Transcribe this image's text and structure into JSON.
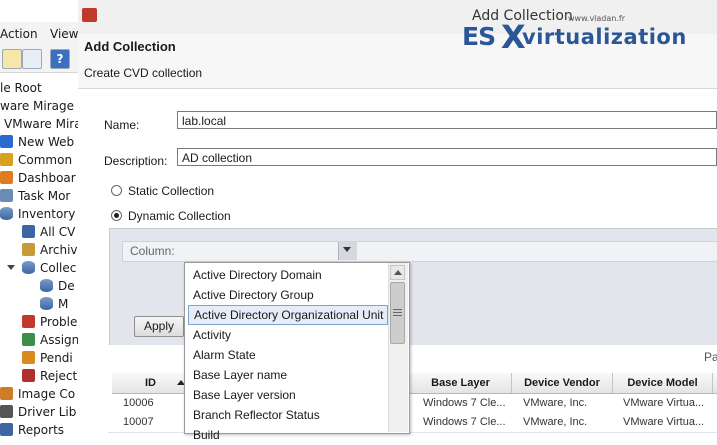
{
  "app": {
    "menu": [
      "Action",
      "View"
    ],
    "tree": [
      {
        "label": "le Root",
        "icon": "none"
      },
      {
        "label": "ware Mirage",
        "icon": "none"
      },
      {
        "label": "VMware Mira",
        "icon": "none"
      },
      {
        "label": "New Web",
        "icon": "web-console-icon"
      },
      {
        "label": "Common",
        "icon": "wand-icon"
      },
      {
        "label": "Dashboar",
        "icon": "dashboard-icon"
      },
      {
        "label": "Task Mor",
        "icon": "task-monitor-icon"
      },
      {
        "label": "Inventory",
        "icon": "database-icon"
      },
      {
        "label": "All CV",
        "icon": "all-cvds-icon"
      },
      {
        "label": "Archiv",
        "icon": "archive-icon"
      },
      {
        "label": "Collec",
        "icon": "database-icon"
      },
      {
        "label": "De",
        "icon": "database-icon"
      },
      {
        "label": "M",
        "icon": "database-icon"
      },
      {
        "label": "Proble",
        "icon": "problem-icon"
      },
      {
        "label": "Assign",
        "icon": "assign-icon"
      },
      {
        "label": "Pendi",
        "icon": "pending-icon"
      },
      {
        "label": "Reject",
        "icon": "reject-icon"
      },
      {
        "label": "Image Co",
        "icon": "image-icon"
      },
      {
        "label": "Driver Lib",
        "icon": "driver-library-icon"
      },
      {
        "label": "Reports",
        "icon": "reports-icon"
      }
    ]
  },
  "dialog": {
    "window_title": "Add Collection",
    "header_title": "Add Collection",
    "header_subtitle": "Create CVD collection",
    "name_label": "Name:",
    "name_value": "lab.local",
    "description_label": "Description:",
    "description_value": "AD collection",
    "static_label": "Static Collection",
    "dynamic_label": "Dynamic Collection",
    "selected_type": "dynamic",
    "column_label": "Column:",
    "apply_label": "Apply",
    "pager_text": "Pa",
    "column_options": [
      "Active Directory Domain",
      "Active Directory Group",
      "Active Directory Organizational Unit",
      "Activity",
      "Alarm State",
      "Base Layer name",
      "Base Layer version",
      "Branch Reflector Status",
      "Build"
    ],
    "selected_option_index": 2,
    "grid": {
      "headers": [
        "ID",
        "Base Layer",
        "Device Vendor",
        "Device Model"
      ],
      "rows": [
        [
          "10006",
          "Windows 7 Cle...",
          "VMware, Inc.",
          "VMware Virtua..."
        ],
        [
          "10007",
          "Windows 7 Cle...",
          "VMware, Inc.",
          "VMware Virtua..."
        ]
      ]
    }
  },
  "watermark": {
    "site": "www.vladan.fr",
    "es": "ES",
    "x": "X",
    "rest": "virtualization"
  },
  "colors": {
    "accent": "#2b5797",
    "selection": "#e4edf8",
    "panel": "#e2e6ec"
  }
}
